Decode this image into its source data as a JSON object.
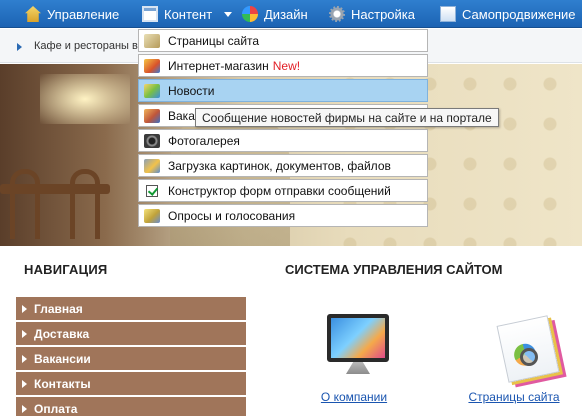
{
  "topnav": {
    "items": [
      {
        "label": "Управление",
        "icon": "home-icon"
      },
      {
        "label": "Контент",
        "icon": "content-icon"
      },
      {
        "label": "Дизайн",
        "icon": "design-palette-icon"
      },
      {
        "label": "Настройка",
        "icon": "settings-gear-icon"
      },
      {
        "label": "Самопродвижение",
        "icon": "promotion-icon"
      }
    ],
    "bg_color": "#1f6bbd"
  },
  "breadcrumb": {
    "text": "Кафе и рестораны в"
  },
  "dropdown": {
    "items": [
      {
        "label": "Страницы сайта",
        "icon": "pages-icon"
      },
      {
        "label": "Интернет-магазин",
        "badge": "New!",
        "icon": "shop-icon"
      },
      {
        "label": "Новости",
        "icon": "news-icon",
        "active": true
      },
      {
        "label": "Вака",
        "icon": "vacancies-icon"
      },
      {
        "label": "Фотогалерея",
        "icon": "camera-icon"
      },
      {
        "label": "Загрузка картинок, документов, файлов",
        "icon": "upload-icon"
      },
      {
        "label": "Конструктор форм отправки сообщений",
        "icon": "checkbox-icon"
      },
      {
        "label": "Опросы и голосования",
        "icon": "poll-icon"
      }
    ],
    "highlight_color": "#a8d3f2",
    "badge_color": "#e21e26"
  },
  "tooltip": {
    "text": "Сообщение новостей фирмы на сайте и на портале"
  },
  "navigation": {
    "title": "НАВИГАЦИЯ",
    "items": [
      "Главная",
      "Доставка",
      "Вакансии",
      "Контакты",
      "Оплата"
    ],
    "item_color": "#a0755a"
  },
  "cms": {
    "title": "СИСТЕМА УПРАВЛЕНИЯ САЙТОМ",
    "cards": [
      {
        "label": "О компании",
        "icon": "monitor-icon"
      },
      {
        "label": "Страницы сайта",
        "icon": "site-pages-icon"
      }
    ],
    "link_color": "#1a55b0"
  }
}
